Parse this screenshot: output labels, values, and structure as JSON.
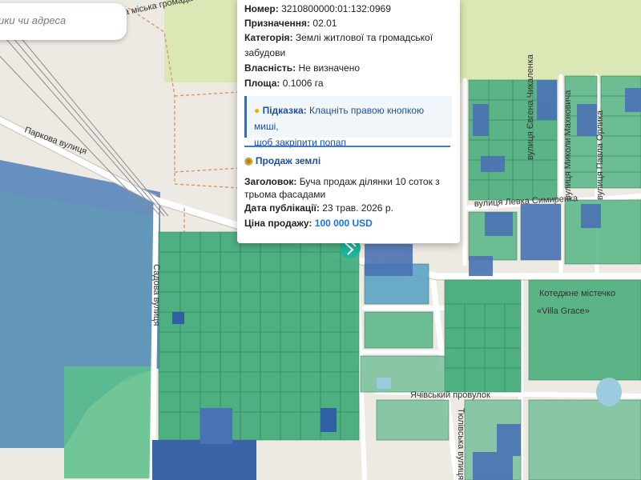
{
  "search": {
    "placeholder": "ики чи адреса"
  },
  "popup": {
    "number_label": "Номер:",
    "number_value": "3210800000:01:132:0969",
    "purpose_label": "Призначення:",
    "purpose_value": "02.01",
    "category_label": "Категорія:",
    "category_value_line1": "Землі житлової та громадської",
    "category_value_line2": "забудови",
    "ownership_label": "Власність:",
    "ownership_value": "Не визначено",
    "area_label": "Площа:",
    "area_value": "0.1006 га",
    "hint_icon": "lightbulb-icon",
    "hint_title": "Підказка:",
    "hint_line1": "Клацніть правою кнопкою миші,",
    "hint_line2": "щоб закріпити попап",
    "sale_icon": "money-bag-icon",
    "sale_title": "Продаж землі",
    "heading_label": "Заголовок:",
    "heading_line1": "Буча продаж ділянки 10 соток з",
    "heading_line2": "трьома фасадами",
    "date_label": "Дата публікації:",
    "date_value": "23 трав. 2026 р.",
    "price_label": "Ціна продажу:",
    "price_value": "100 000 USD"
  },
  "map": {
    "community_label": "ча міська громада",
    "streets": [
      "Паркова вулиця",
      "Садова вулиця",
      "вулиця Левка Симиренка",
      "вулиця Євгена Чикаленка",
      "вулиця Миколи Махновича",
      "вулиця Павла Орлика",
      "Ячівський провулок",
      "Тюлівська вулиця"
    ],
    "poi_name": "Котеджне містечко",
    "poi_subtitle": "«Villa Grace»",
    "marker_icon": "parcel-marker-icon",
    "colors": {
      "parcel_green": "#3daa78",
      "parcel_blue": "#4a72b4",
      "forest": "#b9d9a0",
      "water": "#9ccbe0",
      "road": "#ffffff",
      "background": "#ede9e3"
    }
  }
}
